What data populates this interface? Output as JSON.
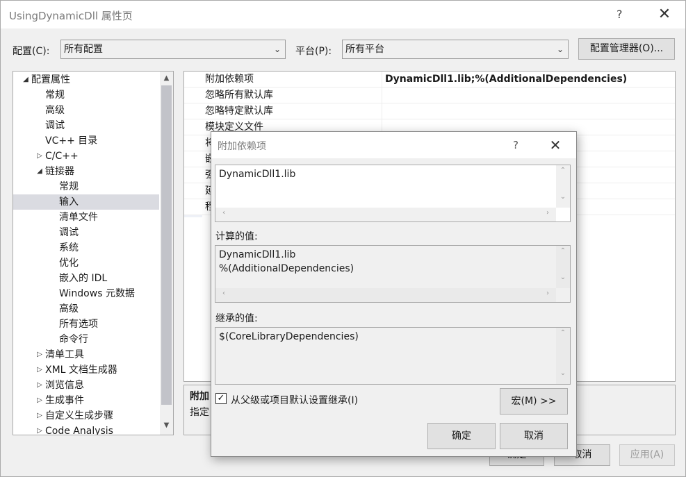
{
  "window": {
    "title": "UsingDynamicDll 属性页",
    "help_glyph": "?",
    "close_glyph": "✕"
  },
  "toolbar": {
    "config_label": "配置(C):",
    "config_value": "所有配置",
    "platform_label": "平台(P):",
    "platform_value": "所有平台",
    "config_manager_button": "配置管理器(O)..."
  },
  "tree": {
    "items": [
      {
        "label": "配置属性",
        "twisty": "◢",
        "indent": 0
      },
      {
        "label": "常规",
        "twisty": "",
        "indent": 1
      },
      {
        "label": "高级",
        "twisty": "",
        "indent": 1
      },
      {
        "label": "调试",
        "twisty": "",
        "indent": 1
      },
      {
        "label": "VC++ 目录",
        "twisty": "",
        "indent": 1
      },
      {
        "label": "C/C++",
        "twisty": "▷",
        "indent": 1
      },
      {
        "label": "链接器",
        "twisty": "◢",
        "indent": 1
      },
      {
        "label": "常规",
        "twisty": "",
        "indent": 2
      },
      {
        "label": "输入",
        "twisty": "",
        "indent": 2,
        "selected": true
      },
      {
        "label": "清单文件",
        "twisty": "",
        "indent": 2
      },
      {
        "label": "调试",
        "twisty": "",
        "indent": 2
      },
      {
        "label": "系统",
        "twisty": "",
        "indent": 2
      },
      {
        "label": "优化",
        "twisty": "",
        "indent": 2
      },
      {
        "label": "嵌入的 IDL",
        "twisty": "",
        "indent": 2
      },
      {
        "label": "Windows 元数据",
        "twisty": "",
        "indent": 2
      },
      {
        "label": "高级",
        "twisty": "",
        "indent": 2
      },
      {
        "label": "所有选项",
        "twisty": "",
        "indent": 2
      },
      {
        "label": "命令行",
        "twisty": "",
        "indent": 2
      },
      {
        "label": "清单工具",
        "twisty": "▷",
        "indent": 1
      },
      {
        "label": "XML 文档生成器",
        "twisty": "▷",
        "indent": 1
      },
      {
        "label": "浏览信息",
        "twisty": "▷",
        "indent": 1
      },
      {
        "label": "生成事件",
        "twisty": "▷",
        "indent": 1
      },
      {
        "label": "自定义生成步骤",
        "twisty": "▷",
        "indent": 1
      },
      {
        "label": "Code Analysis",
        "twisty": "▷",
        "indent": 1
      }
    ]
  },
  "grid": {
    "rows": [
      {
        "name": "附加依赖项",
        "value": "DynamicDll1.lib;%(AdditionalDependencies)"
      },
      {
        "name": "忽略所有默认库",
        "value": ""
      },
      {
        "name": "忽略特定默认库",
        "value": ""
      },
      {
        "name": "模块定义文件",
        "value": ""
      },
      {
        "name": "将",
        "value": ""
      },
      {
        "name": "嵌",
        "value": ""
      },
      {
        "name": "强",
        "value": ""
      },
      {
        "name": "延",
        "value": ""
      },
      {
        "name": "程",
        "value": ""
      }
    ]
  },
  "description": {
    "title": "附加",
    "text": "指定"
  },
  "bottom_buttons": {
    "ok": "确定",
    "cancel": "取消",
    "apply": "应用(A)"
  },
  "modal": {
    "title": "附加依赖项",
    "help_glyph": "?",
    "close_glyph": "✕",
    "edit_value": "DynamicDll1.lib",
    "evaluated_label": "计算的值:",
    "evaluated_value": "DynamicDll1.lib\n%(AdditionalDependencies)",
    "inherited_label": "继承的值:",
    "inherited_value": "$(CoreLibraryDependencies)",
    "inherit_checkbox_label": "从父级或项目默认设置继承(I)",
    "inherit_checked": true,
    "macro_button": "宏(M) >>",
    "ok_button": "确定",
    "cancel_button": "取消"
  },
  "glyphs": {
    "checkmark": "✓",
    "up": "⌃",
    "down": "⌄",
    "left": "‹",
    "right": "›",
    "combo_caret": "⌄",
    "sb_up": "▲",
    "sb_down": "▼"
  }
}
